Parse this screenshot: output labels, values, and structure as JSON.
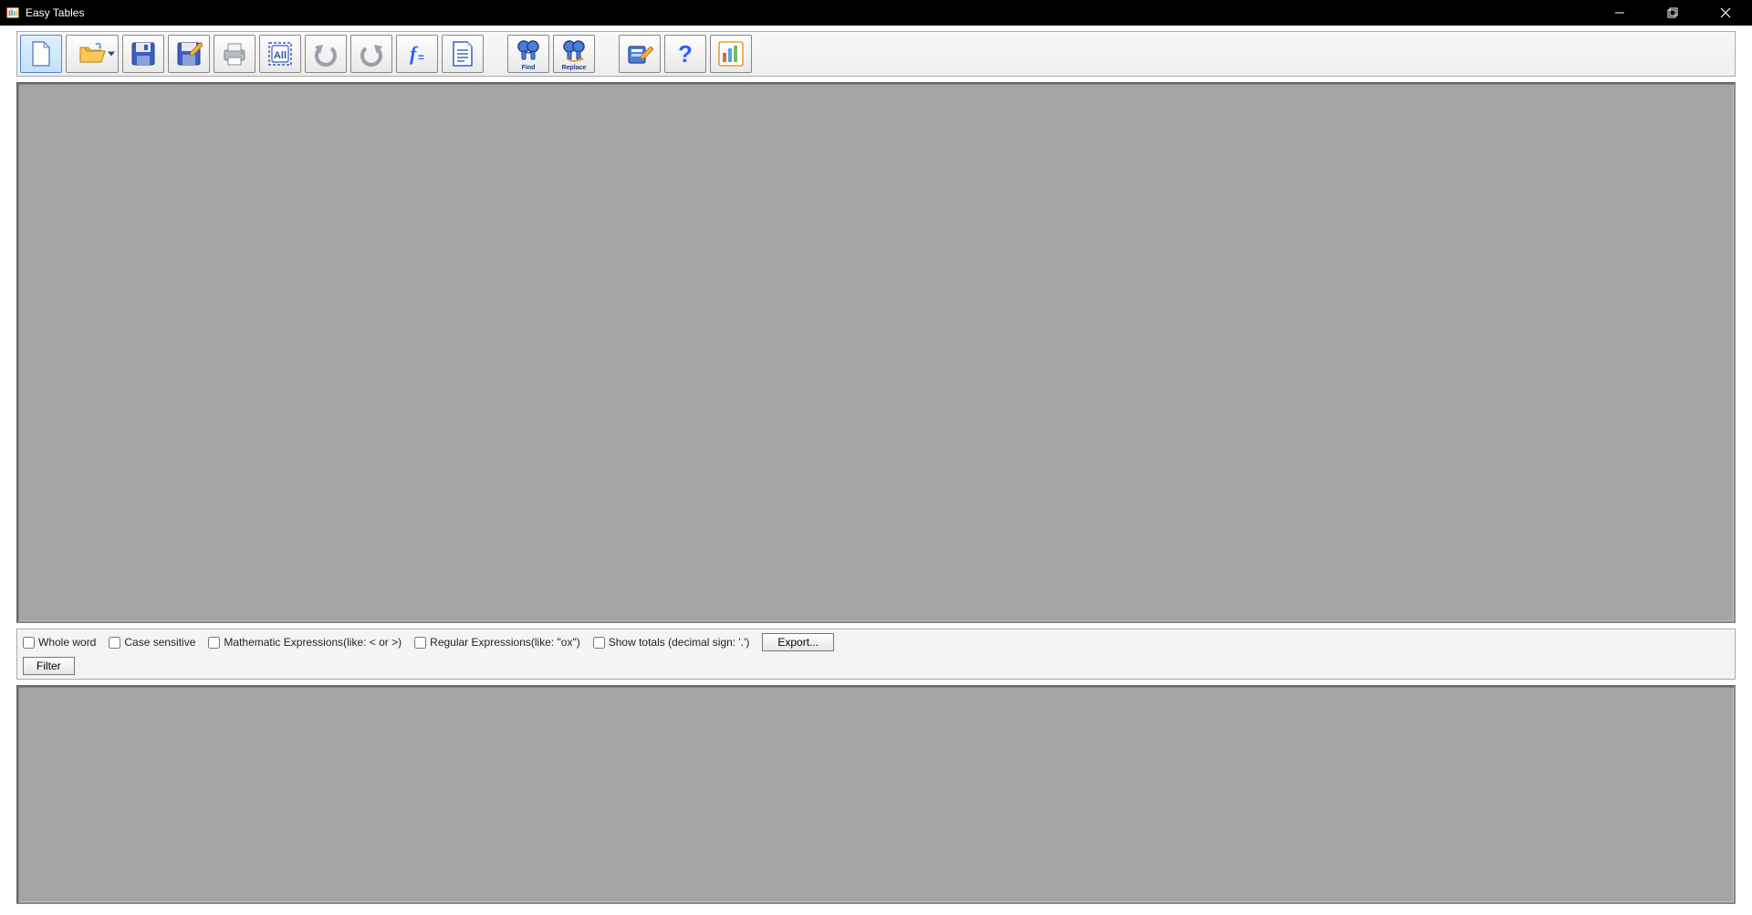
{
  "window": {
    "title": "Easy Tables"
  },
  "toolbar": {
    "find_label": "Find",
    "replace_label": "Replace"
  },
  "filter": {
    "whole_word": "Whole word",
    "case_sensitive": "Case sensitive",
    "math_expr": "Mathematic Expressions(like: < or >)",
    "regex": "Regular Expressions(like: \"ox\")",
    "show_totals": "Show totals (decimal sign: '.')",
    "export": "Export...",
    "filter": "Filter"
  }
}
